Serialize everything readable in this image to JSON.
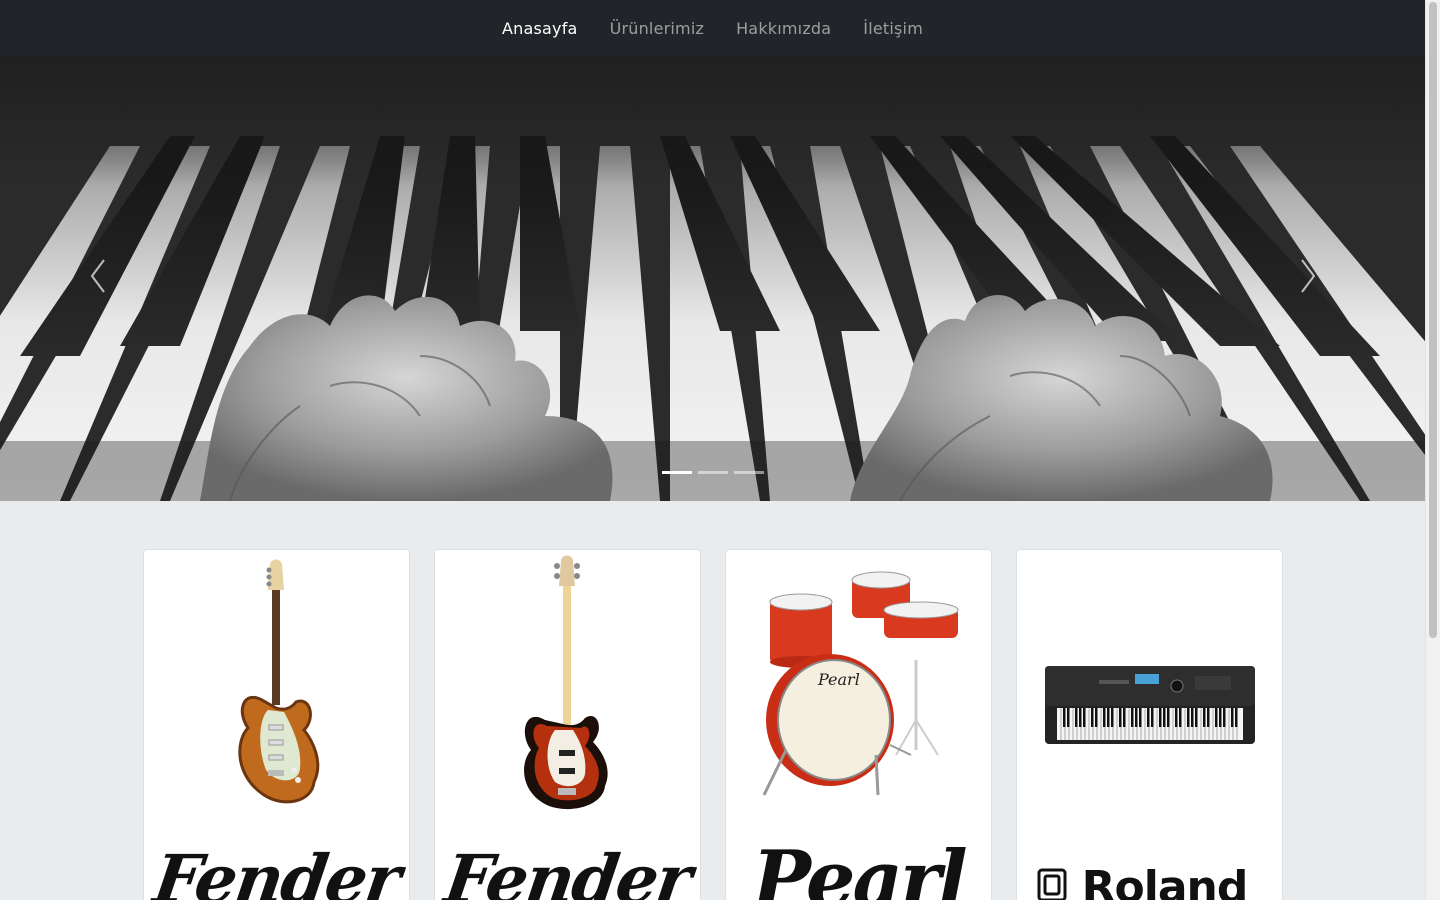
{
  "navbar": {
    "links": [
      {
        "label": "Anasayfa",
        "active": true
      },
      {
        "label": "Ürünlerimiz",
        "active": false
      },
      {
        "label": "Hakkımızda",
        "active": false
      },
      {
        "label": "İletişim",
        "active": false
      }
    ]
  },
  "carousel": {
    "slide_count": 3,
    "active_slide": 1,
    "image": "piano-hands-bw"
  },
  "products": [
    {
      "image": "electric-guitar-sunburst",
      "brand": "Fender"
    },
    {
      "image": "bass-guitar-3tone-sunburst",
      "brand": "Fender"
    },
    {
      "image": "drum-kit-red-sparkle",
      "brand": "Pearl"
    },
    {
      "image": "digital-keyboard",
      "brand": "Roland"
    }
  ],
  "colors": {
    "navbar_bg": "#212529",
    "page_bg": "#e9ecef",
    "nav_active": "#ffffff",
    "nav_inactive": "rgba(255,255,255,0.55)"
  }
}
